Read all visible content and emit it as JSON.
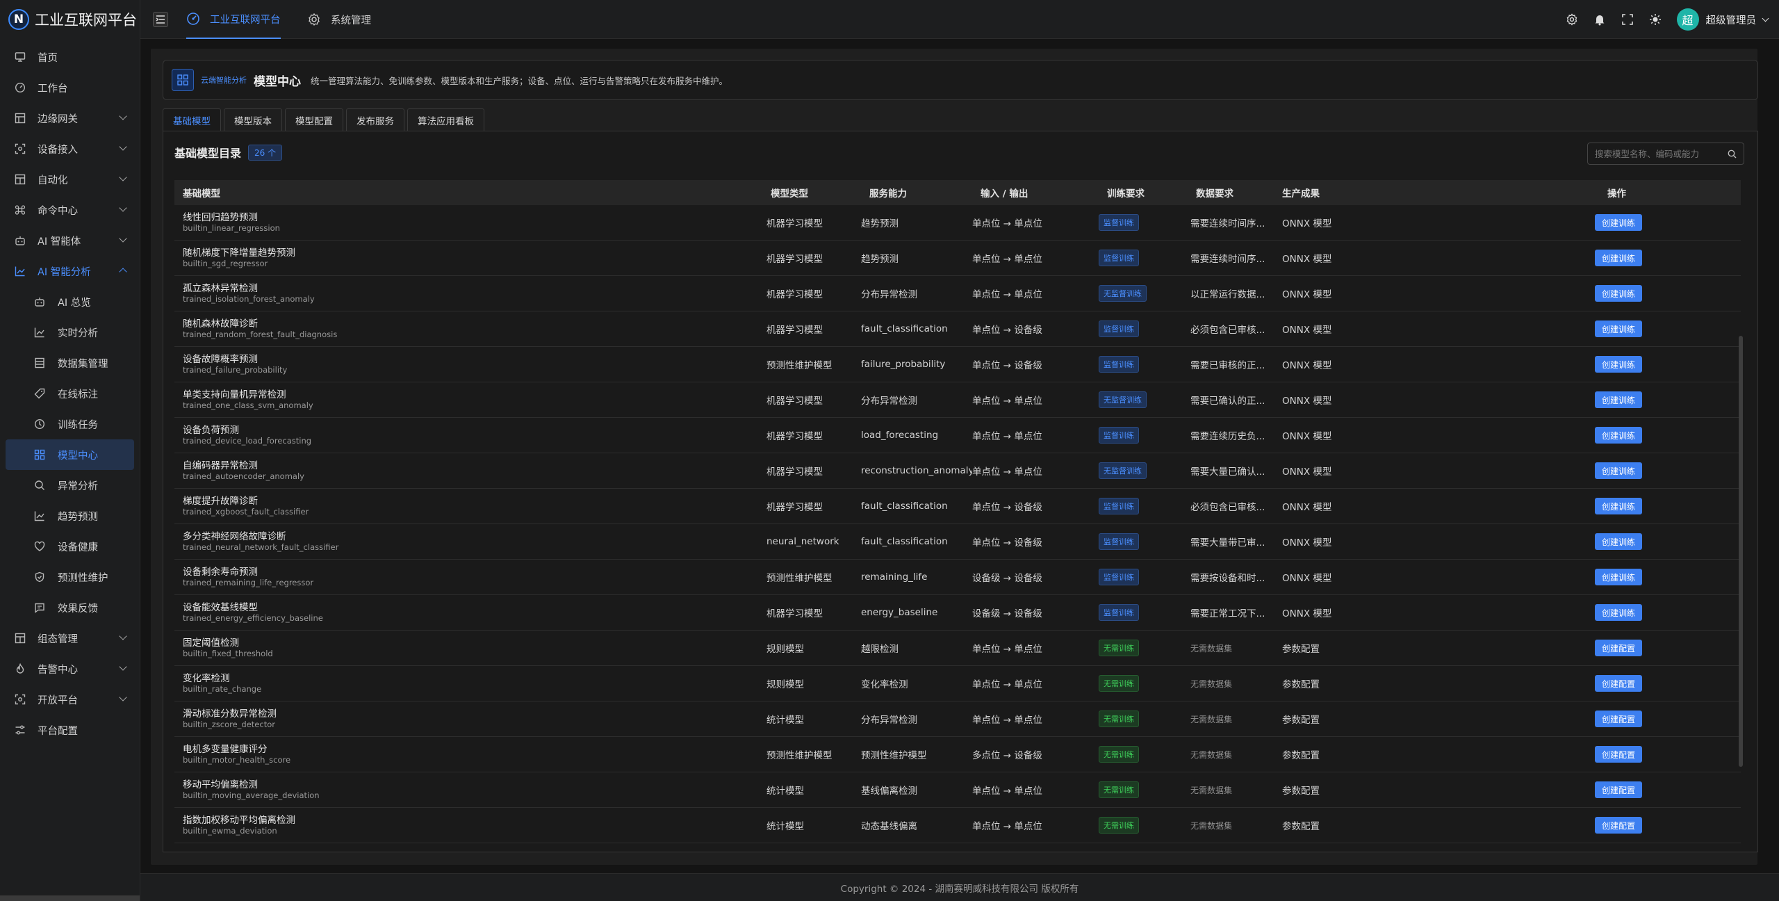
{
  "app": {
    "logo_letter": "N",
    "title": "工业互联网平台"
  },
  "header": {
    "tabs": [
      {
        "label": "工业互联网平台",
        "icon": "dashboard-icon",
        "active": true
      },
      {
        "label": "系统管理",
        "icon": "gear-icon",
        "active": false
      }
    ],
    "user": {
      "avatar": "超",
      "name": "超级管理员"
    }
  },
  "sidebar": {
    "items": [
      {
        "label": "首页",
        "icon": "monitor-icon"
      },
      {
        "label": "工作台",
        "icon": "dashboard-icon"
      },
      {
        "label": "边缘网关",
        "icon": "gateway-icon",
        "expandable": true
      },
      {
        "label": "设备接入",
        "icon": "scan-icon",
        "expandable": true
      },
      {
        "label": "自动化",
        "icon": "layout-icon",
        "expandable": true
      },
      {
        "label": "命令中心",
        "icon": "command-icon",
        "expandable": true
      },
      {
        "label": "AI 智能体",
        "icon": "robot-icon",
        "expandable": true
      },
      {
        "label": "AI 智能分析",
        "icon": "chart-icon",
        "expandable": true,
        "open": true
      }
    ],
    "sub_items": [
      {
        "label": "AI 总览",
        "icon": "robot-icon"
      },
      {
        "label": "实时分析",
        "icon": "chart-icon"
      },
      {
        "label": "数据集管理",
        "icon": "database-icon"
      },
      {
        "label": "在线标注",
        "icon": "tag-icon"
      },
      {
        "label": "训练任务",
        "icon": "clock-icon"
      },
      {
        "label": "模型中心",
        "icon": "grid-icon",
        "active": true
      },
      {
        "label": "异常分析",
        "icon": "search-icon"
      },
      {
        "label": "趋势预测",
        "icon": "chart-icon"
      },
      {
        "label": "设备健康",
        "icon": "heart-icon"
      },
      {
        "label": "预测性维护",
        "icon": "shield-icon"
      },
      {
        "label": "效果反馈",
        "icon": "feedback-icon"
      }
    ],
    "items_after": [
      {
        "label": "组态管理",
        "icon": "layout-icon",
        "expandable": true
      },
      {
        "label": "告警中心",
        "icon": "fire-icon",
        "expandable": true
      },
      {
        "label": "开放平台",
        "icon": "scan-icon",
        "expandable": true
      },
      {
        "label": "平台配置",
        "icon": "sliders-icon"
      }
    ]
  },
  "banner": {
    "tag": "云端智能分析",
    "title": "模型中心",
    "desc": "统一管理算法能力、免训练参数、模型版本和生产服务；设备、点位、运行与告警策略只在发布服务中维护。"
  },
  "tabs": [
    "基础模型",
    "模型版本",
    "模型配置",
    "发布服务",
    "算法应用看板"
  ],
  "catalog": {
    "title": "基础模型目录",
    "count": "26 个",
    "search_placeholder": "搜索模型名称、编码或能力"
  },
  "columns": {
    "name": "基础模型",
    "type": "模型类型",
    "cap": "服务能力",
    "io": "输入 / 输出",
    "train": "训练要求",
    "data": "数据要求",
    "out": "生产成果",
    "op": "操作"
  },
  "rows": [
    {
      "name": "线性回归趋势预测",
      "code": "builtin_linear_regression",
      "type": "机器学习模型",
      "cap": "趋势预测",
      "io": "单点位 → 单点位",
      "train": "监督训练",
      "train_kind": "sup",
      "data": "需要连续时间序...",
      "out": "ONNX 模型",
      "op": "创建训练"
    },
    {
      "name": "随机梯度下降增量趋势预测",
      "code": "builtin_sgd_regressor",
      "type": "机器学习模型",
      "cap": "趋势预测",
      "io": "单点位 → 单点位",
      "train": "监督训练",
      "train_kind": "sup",
      "data": "需要连续时间序...",
      "out": "ONNX 模型",
      "op": "创建训练"
    },
    {
      "name": "孤立森林异常检测",
      "code": "trained_isolation_forest_anomaly",
      "type": "机器学习模型",
      "cap": "分布异常检测",
      "io": "单点位 → 单点位",
      "train": "无监督训练",
      "train_kind": "sup",
      "data": "以正常运行数据...",
      "out": "ONNX 模型",
      "op": "创建训练"
    },
    {
      "name": "随机森林故障诊断",
      "code": "trained_random_forest_fault_diagnosis",
      "type": "机器学习模型",
      "cap": "fault_classification",
      "io": "单点位 → 设备级",
      "train": "监督训练",
      "train_kind": "sup",
      "data": "必须包含已审核...",
      "out": "ONNX 模型",
      "op": "创建训练"
    },
    {
      "name": "设备故障概率预测",
      "code": "trained_failure_probability",
      "type": "预测性维护模型",
      "cap": "failure_probability",
      "io": "单点位 → 设备级",
      "train": "监督训练",
      "train_kind": "sup",
      "data": "需要已审核的正...",
      "out": "ONNX 模型",
      "op": "创建训练"
    },
    {
      "name": "单类支持向量机异常检测",
      "code": "trained_one_class_svm_anomaly",
      "type": "机器学习模型",
      "cap": "分布异常检测",
      "io": "单点位 → 单点位",
      "train": "无监督训练",
      "train_kind": "sup",
      "data": "需要已确认的正...",
      "out": "ONNX 模型",
      "op": "创建训练"
    },
    {
      "name": "设备负荷预测",
      "code": "trained_device_load_forecasting",
      "type": "机器学习模型",
      "cap": "load_forecasting",
      "io": "单点位 → 单点位",
      "train": "监督训练",
      "train_kind": "sup",
      "data": "需要连续历史负...",
      "out": "ONNX 模型",
      "op": "创建训练"
    },
    {
      "name": "自编码器异常检测",
      "code": "trained_autoencoder_anomaly",
      "type": "机器学习模型",
      "cap": "reconstruction_anomaly",
      "io": "单点位 → 单点位",
      "train": "无监督训练",
      "train_kind": "sup",
      "data": "需要大量已确认...",
      "out": "ONNX 模型",
      "op": "创建训练"
    },
    {
      "name": "梯度提升故障诊断",
      "code": "trained_xgboost_fault_classifier",
      "type": "机器学习模型",
      "cap": "fault_classification",
      "io": "单点位 → 设备级",
      "train": "监督训练",
      "train_kind": "sup",
      "data": "必须包含已审核...",
      "out": "ONNX 模型",
      "op": "创建训练"
    },
    {
      "name": "多分类神经网络故障诊断",
      "code": "trained_neural_network_fault_classifier",
      "type": "neural_network",
      "cap": "fault_classification",
      "io": "单点位 → 设备级",
      "train": "监督训练",
      "train_kind": "sup",
      "data": "需要大量带已审...",
      "out": "ONNX 模型",
      "op": "创建训练"
    },
    {
      "name": "设备剩余寿命预测",
      "code": "trained_remaining_life_regressor",
      "type": "预测性维护模型",
      "cap": "remaining_life",
      "io": "设备级 → 设备级",
      "train": "监督训练",
      "train_kind": "sup",
      "data": "需要按设备和时...",
      "out": "ONNX 模型",
      "op": "创建训练"
    },
    {
      "name": "设备能效基线模型",
      "code": "trained_energy_efficiency_baseline",
      "type": "机器学习模型",
      "cap": "energy_baseline",
      "io": "设备级 → 设备级",
      "train": "监督训练",
      "train_kind": "sup",
      "data": "需要正常工况下...",
      "out": "ONNX 模型",
      "op": "创建训练"
    },
    {
      "name": "固定阈值检测",
      "code": "builtin_fixed_threshold",
      "type": "规则模型",
      "cap": "越限检测",
      "io": "单点位 → 单点位",
      "train": "无需训练",
      "train_kind": "none",
      "data": "无需数据集",
      "data_muted": true,
      "out": "参数配置",
      "op": "创建配置"
    },
    {
      "name": "变化率检测",
      "code": "builtin_rate_change",
      "type": "规则模型",
      "cap": "变化率检测",
      "io": "单点位 → 单点位",
      "train": "无需训练",
      "train_kind": "none",
      "data": "无需数据集",
      "data_muted": true,
      "out": "参数配置",
      "op": "创建配置"
    },
    {
      "name": "滑动标准分数异常检测",
      "code": "builtin_zscore_detector",
      "type": "统计模型",
      "cap": "分布异常检测",
      "io": "单点位 → 单点位",
      "train": "无需训练",
      "train_kind": "none",
      "data": "无需数据集",
      "data_muted": true,
      "out": "参数配置",
      "op": "创建配置"
    },
    {
      "name": "电机多变量健康评分",
      "code": "builtin_motor_health_score",
      "type": "预测性维护模型",
      "cap": "预测性维护模型",
      "io": "多点位 → 设备级",
      "train": "无需训练",
      "train_kind": "none",
      "data": "无需数据集",
      "data_muted": true,
      "out": "参数配置",
      "op": "创建配置"
    },
    {
      "name": "移动平均偏离检测",
      "code": "builtin_moving_average_deviation",
      "type": "统计模型",
      "cap": "基线偏离检测",
      "io": "单点位 → 单点位",
      "train": "无需训练",
      "train_kind": "none",
      "data": "无需数据集",
      "data_muted": true,
      "out": "参数配置",
      "op": "创建配置"
    },
    {
      "name": "指数加权移动平均偏离检测",
      "code": "builtin_ewma_deviation",
      "type": "统计模型",
      "cap": "动态基线偏离",
      "io": "单点位 → 单点位",
      "train": "无需训练",
      "train_kind": "none",
      "data": "无需数据集",
      "data_muted": true,
      "out": "参数配置",
      "op": "创建配置"
    }
  ],
  "footer": "Copyright © 2024 - 湖南赛明威科技有限公司 版权所有",
  "colors": {
    "accent": "#3d7ff0",
    "success": "#3fd15b",
    "bg": "#141414"
  }
}
